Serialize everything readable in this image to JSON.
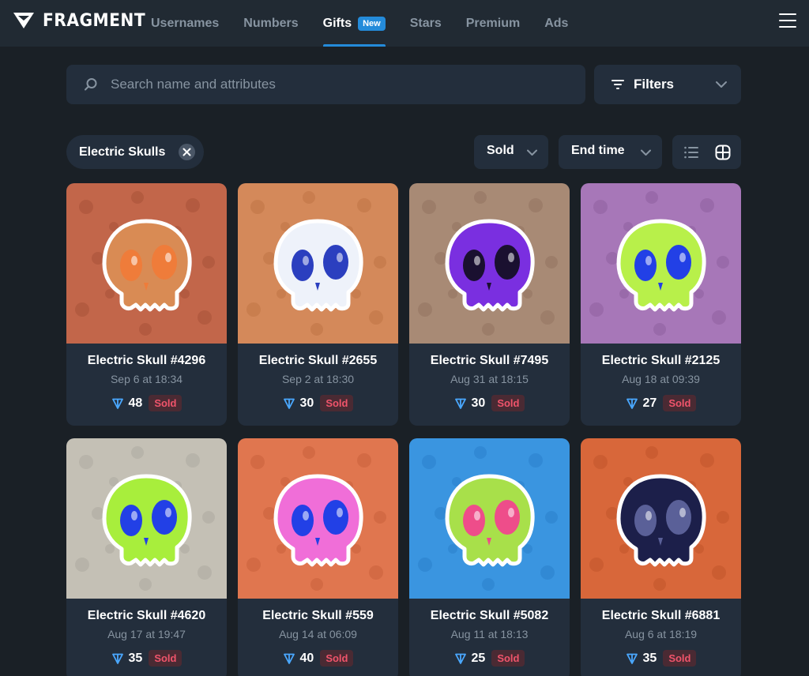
{
  "header": {
    "logo_text": "FRAGMENT",
    "nav": [
      {
        "label": "Usernames"
      },
      {
        "label": "Numbers"
      },
      {
        "label": "Gifts",
        "badge": "New"
      },
      {
        "label": "Stars"
      },
      {
        "label": "Premium"
      },
      {
        "label": "Ads"
      }
    ]
  },
  "search": {
    "placeholder": "Search name and attributes",
    "value": ""
  },
  "filters": {
    "label": "Filters"
  },
  "active_filter_tag": {
    "label": "Electric Skulls"
  },
  "sort": {
    "status_label": "Sold",
    "order_label": "End time"
  },
  "colors": {
    "accent": "#248bda",
    "sold_text": "#f0546b",
    "card_bg": "#232e3c"
  },
  "cards": [
    {
      "title": "Electric Skull #4296",
      "date": "Sep 6 at 18:34",
      "price": "48",
      "status": "Sold",
      "bg": "#c2664a",
      "bg_dark": "#a85238",
      "skull": "#d98b54",
      "accent": "#ef7c3a"
    },
    {
      "title": "Electric Skull #2655",
      "date": "Sep 2 at 18:30",
      "price": "30",
      "status": "Sold",
      "bg": "#d4895a",
      "bg_dark": "#bf7445",
      "skull": "#eef2fa",
      "accent": "#2b3fbf"
    },
    {
      "title": "Electric Skull #7495",
      "date": "Aug 31 at 18:15",
      "price": "30",
      "status": "Sold",
      "bg": "#a88a75",
      "bg_dark": "#937461",
      "skull": "#7a2fe0",
      "accent": "#1a1030"
    },
    {
      "title": "Electric Skull #2125",
      "date": "Aug 18 at 09:39",
      "price": "27",
      "status": "Sold",
      "bg": "#a777b8",
      "bg_dark": "#8f609f",
      "skull": "#b8f04a",
      "accent": "#2240e6"
    },
    {
      "title": "Electric Skull #4620",
      "date": "Aug 17 at 19:47",
      "price": "35",
      "status": "Sold",
      "bg": "#c4c0b5",
      "bg_dark": "#aeaaa0",
      "skull": "#a8ee3c",
      "accent": "#2240e6"
    },
    {
      "title": "Electric Skull #559",
      "date": "Aug 14 at 06:09",
      "price": "40",
      "status": "Sold",
      "bg": "#e0764f",
      "bg_dark": "#c9613c",
      "skull": "#f06ed8",
      "accent": "#2240e6"
    },
    {
      "title": "Electric Skull #5082",
      "date": "Aug 11 at 18:13",
      "price": "25",
      "status": "Sold",
      "bg": "#3a95e0",
      "bg_dark": "#2b80cc",
      "skull": "#a8e04a",
      "accent": "#ee4d8a"
    },
    {
      "title": "Electric Skull #6881",
      "date": "Aug 6 at 18:19",
      "price": "35",
      "status": "Sold",
      "bg": "#d8673a",
      "bg_dark": "#c1552b",
      "skull": "#1c1f4a",
      "accent": "#5a6098"
    }
  ]
}
